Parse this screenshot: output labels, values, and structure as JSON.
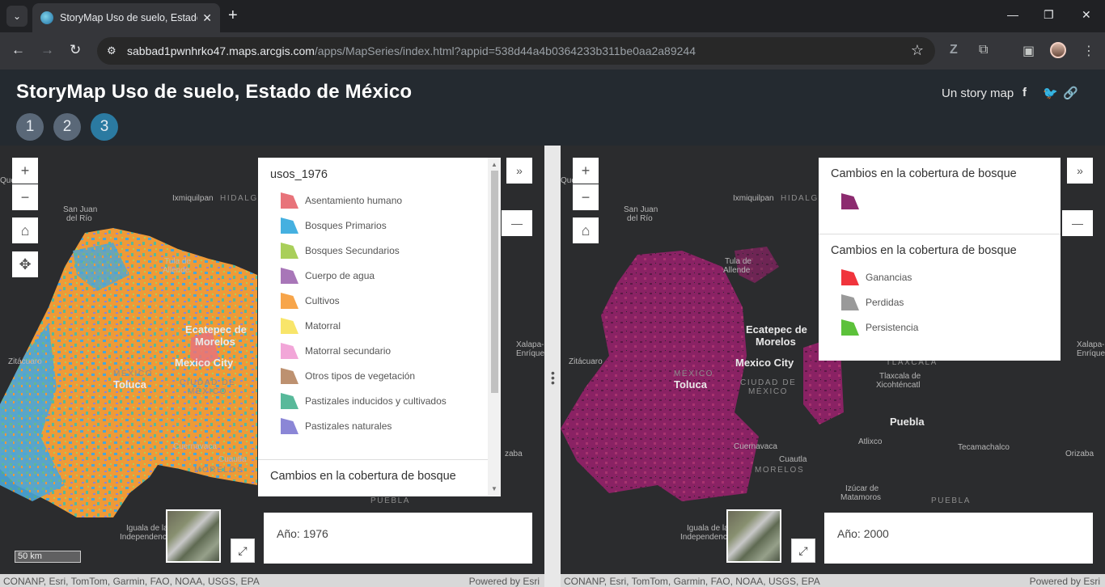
{
  "browser": {
    "tab_title": "StoryMap Uso de suelo, Estado",
    "url_domain": "sabbad1pwnhrko47.maps.arcgis.com",
    "url_path": "/apps/MapSeries/index.html?appid=538d44a4b0364233b311be0aa2a89244"
  },
  "app": {
    "title": "StoryMap Uso de suelo, Estado de México",
    "entries": [
      "1",
      "2",
      "3"
    ],
    "active_entry": "3",
    "story_label": "Un story map"
  },
  "map_labels": {
    "queretaro": "Querétaro",
    "ixmiquilpan": "Ixmiquilpan",
    "hidalgo": "HIDALGO",
    "san_juan": "San Juan",
    "del_rio": "del Río",
    "tula": "Tula de",
    "allende": "Allende",
    "ecatepec": "Ecatepec de",
    "morelos_city": "Morelos",
    "mexico_city": "Mexico City",
    "ciudad_de": "CIUDAD DE",
    "mexico_state": "MÉXICO",
    "mexico_state2": "MÉXICO",
    "toluca": "Toluca",
    "zitacuaro": "Zitácuaro",
    "cuernavaca": "Cuernavaca",
    "cuautla": "Cuautla",
    "morelos_state": "MORELOS",
    "iguala": "Iguala de la",
    "independencia": "Independencia",
    "xalapa": "Xalapa-",
    "enriquez": "Enríquez",
    "izabal": "zaba",
    "puebla_state": "PUEBLA",
    "tlaxcala_state": "TLAXCALA",
    "tlaxcala_de": "Tlaxcala de",
    "xicohtencatl": "Xicohténcatl",
    "puebla_city": "Puebla",
    "atlixco": "Atlixco",
    "tecamachalco": "Tecamachalco",
    "orizaba": "Orizaba",
    "izucar": "Izúcar de",
    "matamoros": "Matamoros"
  },
  "left_legend": {
    "title": "usos_1976",
    "items": [
      {
        "label": "Asentamiento humano",
        "color": "#e8737a"
      },
      {
        "label": "Bosques Primarios",
        "color": "#45b0e0"
      },
      {
        "label": "Bosques Secundarios",
        "color": "#a9cf5a"
      },
      {
        "label": "Cuerpo de agua",
        "color": "#a876b8"
      },
      {
        "label": "Cultivos",
        "color": "#f7a54a"
      },
      {
        "label": "Matorral",
        "color": "#f8e56a"
      },
      {
        "label": "Matorral secundario",
        "color": "#f2a6d8"
      },
      {
        "label": "Otros tipos de vegetación",
        "color": "#bd9170"
      },
      {
        "label": "Pastizales inducidos y cultivados",
        "color": "#58b99a"
      },
      {
        "label": "Pastizales naturales",
        "color": "#8b86d6"
      }
    ],
    "next_title": "Cambios en la cobertura de bosque"
  },
  "right_legend": {
    "title1": "Cambios en la cobertura de bosque",
    "swatch1_color": "#8c2b6f",
    "title2": "Cambios en la cobertura de bosque",
    "items": [
      {
        "label": "Ganancias",
        "color": "#f0343c"
      },
      {
        "label": "Perdidas",
        "color": "#9a9a9a"
      },
      {
        "label": "Persistencia",
        "color": "#5cc13a"
      }
    ]
  },
  "left_year": "Año: 1976",
  "right_year": "Año: 2000",
  "scale_label": "50 km",
  "attribution": "CONANP, Esri, TomTom, Garmin, FAO, NOAA, USGS, EPA",
  "powered": "Powered by Esri",
  "colors": {
    "header_bg": "#242a30",
    "active_entry": "#2b7aa1",
    "entry": "#5a6878"
  }
}
